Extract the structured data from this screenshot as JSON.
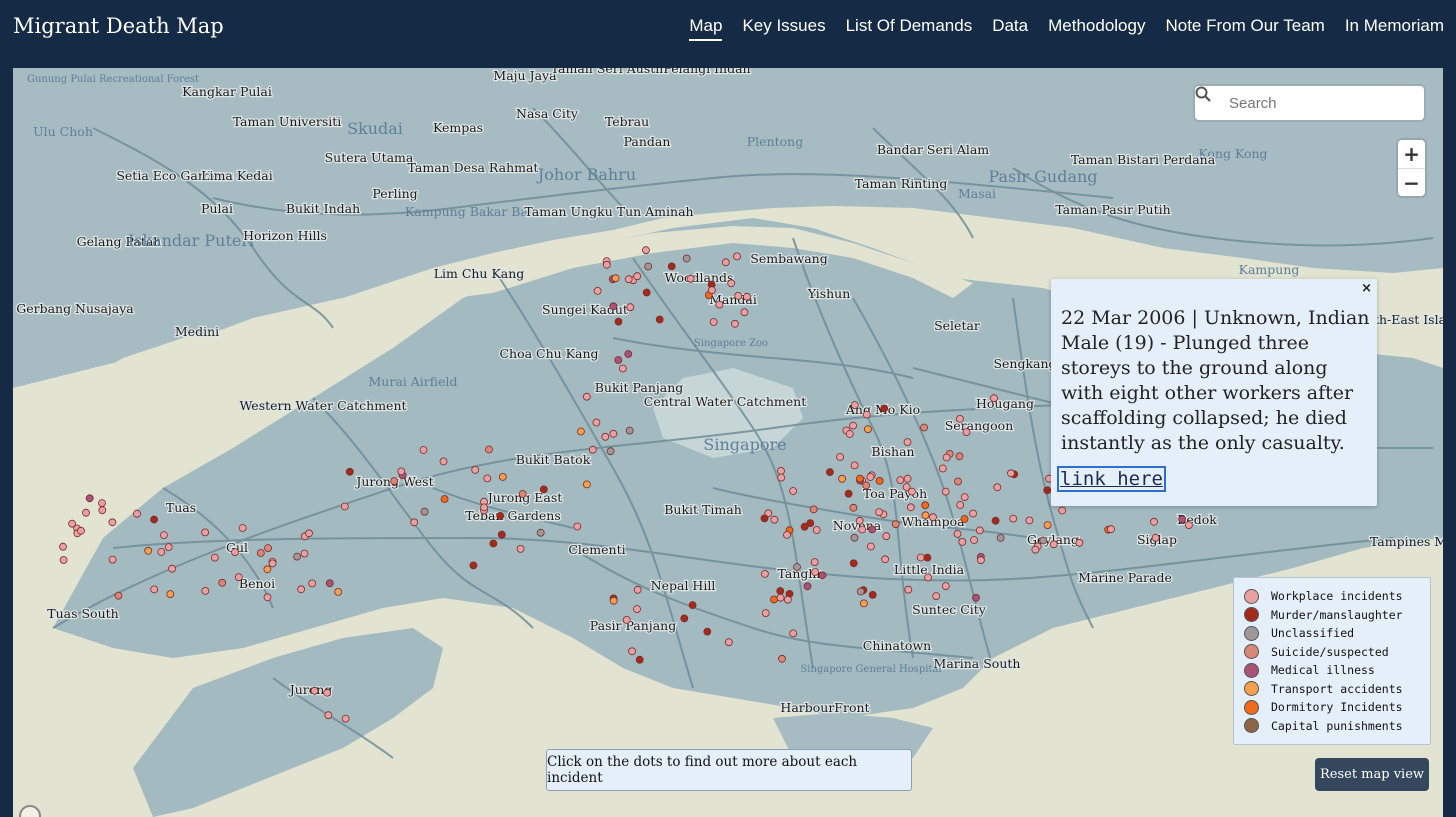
{
  "header": {
    "title": "Migrant Death Map",
    "nav": [
      "Map",
      "Key Issues",
      "List Of Demands",
      "Data",
      "Methodology",
      "Note From Our Team",
      "In Memoriam"
    ],
    "active_nav": "Map"
  },
  "search": {
    "placeholder": "Search"
  },
  "zoom": {
    "in": "+",
    "out": "−"
  },
  "popup": {
    "close": "×",
    "text": "22 Mar 2006 | Unknown, Indian Male (19) - Plunged three storeys to the ground along with eight other workers after scaffolding collapsed; he died instantly as the only casualty.",
    "link": "link here"
  },
  "legend": [
    {
      "label": "Workplace incidents",
      "color": "#e8a1a3"
    },
    {
      "label": "Murder/manslaughter",
      "color": "#a32b1c"
    },
    {
      "label": "Unclassified",
      "color": "#9e9898"
    },
    {
      "label": "Suicide/suspected",
      "color": "#d98877"
    },
    {
      "label": "Medical illness",
      "color": "#a85377"
    },
    {
      "label": "Transport accidents",
      "color": "#f3a04f"
    },
    {
      "label": "Dormitory Incidents",
      "color": "#ef6b1c"
    },
    {
      "label": "Capital punishments",
      "color": "#8c6647"
    }
  ],
  "hint": "Click on the dots to find out more about each incident",
  "reset_button": "Reset map view",
  "place_labels": [
    "Gunung Pulai Recreational Forest",
    "Kangkar Pulai",
    "Maju Jaya",
    "Taman Seri Austin",
    "Pelangi Indah",
    "Ulu Choh",
    "Taman Universiti",
    "Skudai",
    "Kempas",
    "Nasa City",
    "Tebrau",
    "Pandan",
    "Plentong",
    "Bandar Seri Alam",
    "Kong Kong",
    "Setia Eco Gardens",
    "Lima Kedai",
    "Sutera Utama",
    "Taman Desa Rahmat",
    "Johor Bahru",
    "Taman Rinting",
    "Masai",
    "Pasir Gudang",
    "Taman Bistari Perdana",
    "Pulai",
    "Bukit Indah",
    "Perling",
    "Kampung Bakar Batu",
    "Taman Ungku Tun Aminah",
    "Taman Pasir Putih",
    "Gelang Patah",
    "Iskandar Puteri",
    "Horizon Hills",
    "Lim Chu Kang",
    "Woodlands",
    "Sembawang",
    "Mandai",
    "Yishun",
    "Kampung",
    "Gerbang Nusajaya",
    "Sungei Kadut",
    "Seletar",
    "Medini",
    "Singapore Zoo",
    "Choa Chu Kang",
    "Sengkang",
    "North-East Islands",
    "Murai Airfield",
    "Bukit Panjang",
    "Central Water Catchment",
    "Ang Mo Kio",
    "Hougang",
    "Western Water Catchment",
    "Serangoon",
    "Bukit Batok",
    "Singapore",
    "Bishan",
    "Jurong West",
    "Jurong East",
    "Toa Payoh",
    "Tuas",
    "Bukit Timah",
    "Novena",
    "Whampoa",
    "Bedok",
    "Teban Gardens",
    "Clementi",
    "Geylang",
    "Siglap",
    "Tampines Merah",
    "Gul",
    "Little India",
    "Benoi",
    "Tanglin",
    "Marine Parade",
    "Tuas South",
    "Nepal Hill",
    "Suntec City",
    "Pasir Panjang",
    "Chinatown",
    "Marina South",
    "Singapore General Hospital",
    "Jurong",
    "HarbourFront"
  ]
}
